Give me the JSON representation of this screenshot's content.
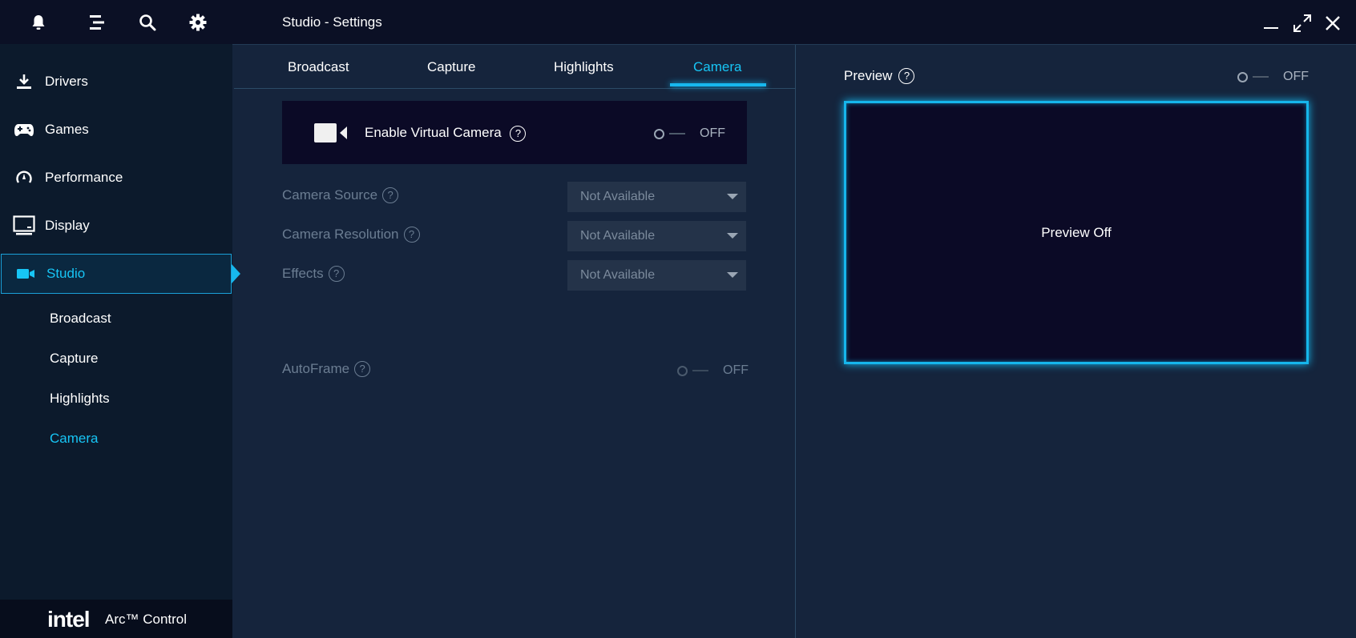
{
  "window": {
    "title": "Studio - Settings",
    "controls": [
      "minimize-icon",
      "maximize-icon",
      "close-icon"
    ]
  },
  "topbar_icons": [
    "bell-icon",
    "menu-icon",
    "search-icon",
    "gear-icon"
  ],
  "sidebar": {
    "items": [
      {
        "label": "Drivers",
        "icon": "download-icon"
      },
      {
        "label": "Games",
        "icon": "gamepad-icon"
      },
      {
        "label": "Performance",
        "icon": "gauge-icon"
      },
      {
        "label": "Display",
        "icon": "monitor-icon"
      },
      {
        "label": "Studio",
        "icon": "video-camera-icon",
        "active": true
      }
    ],
    "subitems": [
      {
        "label": "Broadcast"
      },
      {
        "label": "Capture"
      },
      {
        "label": "Highlights"
      },
      {
        "label": "Camera",
        "active": true
      }
    ],
    "brand": {
      "logo_text": "intel",
      "product": "Arc™ Control"
    }
  },
  "tabs": [
    {
      "label": "Broadcast"
    },
    {
      "label": "Capture"
    },
    {
      "label": "Highlights"
    },
    {
      "label": "Camera",
      "active": true
    }
  ],
  "virtual_camera": {
    "label": "Enable Virtual Camera",
    "help": "?",
    "toggle": "OFF"
  },
  "fields": [
    {
      "label": "Camera Source",
      "help": "?",
      "value": "Not Available"
    },
    {
      "label": "Camera Resolution",
      "help": "?",
      "value": "Not Available"
    },
    {
      "label": "Effects",
      "help": "?",
      "value": "Not Available"
    }
  ],
  "autoframe": {
    "label": "AutoFrame",
    "help": "?",
    "toggle": "OFF"
  },
  "preview": {
    "label": "Preview",
    "help": "?",
    "toggle": "OFF",
    "screen_text": "Preview Off"
  },
  "colors": {
    "accent": "#17c5f5",
    "sidebar_bg": "#0c1a2c",
    "content_bg": "#15243c",
    "card_bg": "#0b0a26"
  }
}
